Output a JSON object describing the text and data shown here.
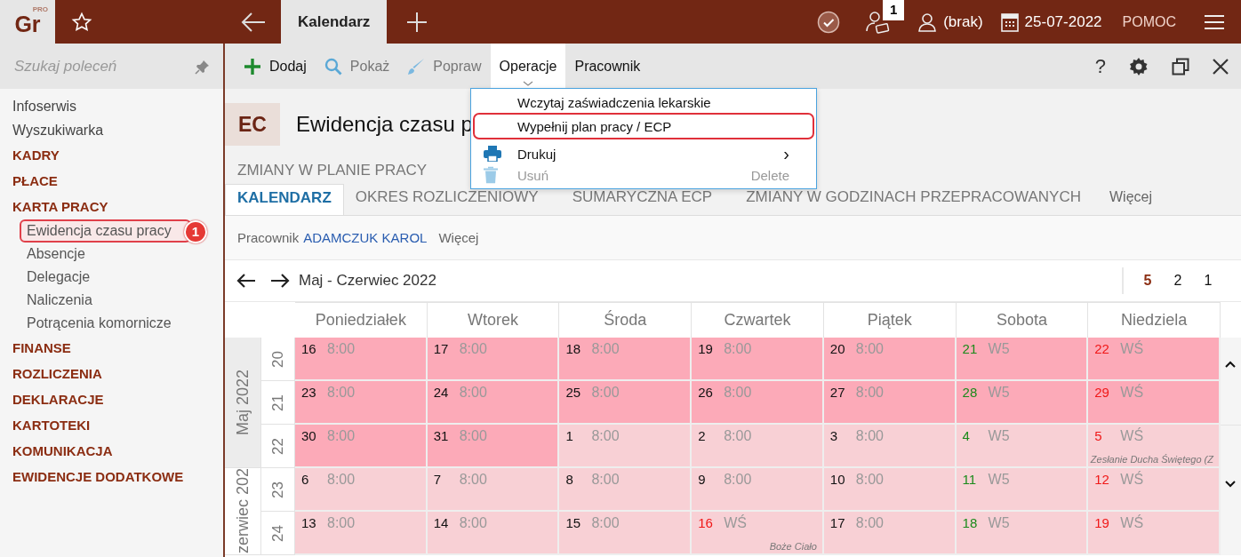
{
  "topbar": {
    "logo": "Gr",
    "logo_badge": "PRO",
    "tabs": [
      {
        "label": "Kalendarz",
        "selected": true
      }
    ],
    "notification_count": "1",
    "user": "(brak)",
    "date": "25-07-2022",
    "help": "POMOC"
  },
  "sidebar": {
    "search": {
      "placeholder": "Szukaj poleceń"
    },
    "items": [
      {
        "label": "Infoserwis",
        "kind": "link"
      },
      {
        "label": "Wyszukiwarka",
        "kind": "link"
      },
      {
        "label": "KADRY",
        "kind": "section"
      },
      {
        "label": "PŁACE",
        "kind": "section"
      },
      {
        "label": "KARTA PRACY",
        "kind": "section",
        "children": [
          {
            "label": "Ewidencja czasu pracy",
            "selected": true,
            "callout": "1"
          },
          {
            "label": "Absencje",
            "selected": false
          },
          {
            "label": "Delegacje",
            "selected": false
          },
          {
            "label": "Naliczenia",
            "selected": false
          },
          {
            "label": "Potrącenia komornicze",
            "selected": false
          }
        ]
      },
      {
        "label": "FINANSE",
        "kind": "section"
      },
      {
        "label": "ROZLICZENIA",
        "kind": "section"
      },
      {
        "label": "DEKLARACJE",
        "kind": "section"
      },
      {
        "label": "KARTOTEKI",
        "kind": "section"
      },
      {
        "label": "KOMUNIKACJA",
        "kind": "section"
      },
      {
        "label": "EWIDENCJE DODATKOWE",
        "kind": "section"
      }
    ]
  },
  "toolbar": {
    "actions": [
      {
        "label": "Dodaj",
        "kind": "add",
        "disabled": false,
        "selected": false
      },
      {
        "label": "Pokaż",
        "kind": "view",
        "disabled": true,
        "selected": false
      },
      {
        "label": "Popraw",
        "kind": "edit",
        "disabled": true,
        "selected": false
      },
      {
        "label": "Operacje",
        "kind": "menu",
        "disabled": false,
        "selected": true
      },
      {
        "label": "Pracownik",
        "kind": "menu",
        "disabled": false,
        "selected": false
      }
    ],
    "help_label": "?"
  },
  "menu": {
    "items": [
      {
        "label": "Wczytaj zaświadczenia lekarskie",
        "kind": "plain",
        "highlighted": false,
        "disabled": false
      },
      {
        "label": "Wypełnij plan pracy / ECP",
        "kind": "plain",
        "highlighted": true,
        "disabled": false
      },
      {
        "label": "Drukuj",
        "kind": "print",
        "submenu": "›",
        "highlighted": false,
        "disabled": false
      },
      {
        "label": "Usuń",
        "kind": "delete",
        "shortcut": "Delete",
        "highlighted": false,
        "disabled": true
      }
    ]
  },
  "header": {
    "badge": "EC",
    "title": "Ewidencja czasu p",
    "subtitle": "ZMIANY W PLANIE PRACY"
  },
  "tabs": [
    {
      "label": "KALENDARZ",
      "selected": true
    },
    {
      "label": "OKRES ROZLICZENIOWY",
      "selected": false
    },
    {
      "label": "SUMARYCZNA ECP",
      "selected": false
    },
    {
      "label": "ZMIANY W GODZINACH PRZEPRACOWANYCH",
      "selected": false
    }
  ],
  "tabs_more": "Więcej",
  "employee": {
    "label": "Pracownik",
    "name": "ADAMCZUK KAROL",
    "more": "Więcej"
  },
  "calendar": {
    "period": "Maj - Czerwiec 2022",
    "view_options": [
      {
        "label": "5",
        "selected": true
      },
      {
        "label": "2",
        "selected": false
      },
      {
        "label": "1",
        "selected": false
      }
    ],
    "weekdays": [
      "Poniedziałek",
      "Wtorek",
      "Środa",
      "Czwartek",
      "Piątek",
      "Sobota",
      "Niedziela"
    ],
    "months": [
      {
        "label": "Maj 2022",
        "highlighted": true,
        "weeks": [
          {
            "number": "20",
            "days": [
              {
                "day": "16",
                "kind": "work",
                "hours": "8:00",
                "highlighted": true
              },
              {
                "day": "17",
                "kind": "work",
                "hours": "8:00",
                "highlighted": true
              },
              {
                "day": "18",
                "kind": "work",
                "hours": "8:00",
                "highlighted": true
              },
              {
                "day": "19",
                "kind": "work",
                "hours": "8:00",
                "highlighted": true
              },
              {
                "day": "20",
                "kind": "work",
                "hours": "8:00",
                "highlighted": true
              },
              {
                "day": "21",
                "kind": "saturday",
                "hours": "W5",
                "highlighted": true
              },
              {
                "day": "22",
                "kind": "holiday",
                "hours": "WŚ",
                "highlighted": true
              }
            ]
          },
          {
            "number": "21",
            "days": [
              {
                "day": "23",
                "kind": "work",
                "hours": "8:00",
                "highlighted": true
              },
              {
                "day": "24",
                "kind": "work",
                "hours": "8:00",
                "highlighted": true
              },
              {
                "day": "25",
                "kind": "work",
                "hours": "8:00",
                "highlighted": true
              },
              {
                "day": "26",
                "kind": "work",
                "hours": "8:00",
                "highlighted": true
              },
              {
                "day": "27",
                "kind": "work",
                "hours": "8:00",
                "highlighted": true
              },
              {
                "day": "28",
                "kind": "saturday",
                "hours": "W5",
                "highlighted": true
              },
              {
                "day": "29",
                "kind": "holiday",
                "hours": "WŚ",
                "highlighted": true
              }
            ]
          },
          {
            "number": "22",
            "days": [
              {
                "day": "30",
                "kind": "work",
                "hours": "8:00",
                "highlighted": true
              },
              {
                "day": "31",
                "kind": "work",
                "hours": "8:00",
                "highlighted": true
              },
              {
                "day": "1",
                "kind": "work",
                "hours": "8:00",
                "highlighted": false
              },
              {
                "day": "2",
                "kind": "work",
                "hours": "8:00",
                "highlighted": false
              },
              {
                "day": "3",
                "kind": "work",
                "hours": "8:00",
                "highlighted": false
              },
              {
                "day": "4",
                "kind": "saturday",
                "hours": "W5",
                "highlighted": false
              },
              {
                "day": "5",
                "kind": "holiday",
                "hours": "WŚ",
                "highlighted": false,
                "note": "Zesłanie Ducha Świętego (Z"
              }
            ]
          }
        ]
      },
      {
        "label": "zerwiec 202",
        "highlighted": false,
        "weeks": [
          {
            "number": "23",
            "days": [
              {
                "day": "6",
                "kind": "work",
                "hours": "8:00",
                "highlighted": false
              },
              {
                "day": "7",
                "kind": "work",
                "hours": "8:00",
                "highlighted": false
              },
              {
                "day": "8",
                "kind": "work",
                "hours": "8:00",
                "highlighted": false
              },
              {
                "day": "9",
                "kind": "work",
                "hours": "8:00",
                "highlighted": false
              },
              {
                "day": "10",
                "kind": "work",
                "hours": "8:00",
                "highlighted": false
              },
              {
                "day": "11",
                "kind": "saturday",
                "hours": "W5",
                "highlighted": false
              },
              {
                "day": "12",
                "kind": "holiday",
                "hours": "WŚ",
                "highlighted": false
              }
            ]
          },
          {
            "number": "24",
            "days": [
              {
                "day": "13",
                "kind": "work",
                "hours": "8:00",
                "highlighted": false
              },
              {
                "day": "14",
                "kind": "work",
                "hours": "8:00",
                "highlighted": false
              },
              {
                "day": "15",
                "kind": "work",
                "hours": "8:00",
                "highlighted": false
              },
              {
                "day": "16",
                "kind": "holiday",
                "hours": "WŚ",
                "highlighted": false,
                "note": "Boże Ciało"
              },
              {
                "day": "17",
                "kind": "work",
                "hours": "8:00",
                "highlighted": false
              },
              {
                "day": "18",
                "kind": "saturday",
                "hours": "W5",
                "highlighted": false
              },
              {
                "day": "19",
                "kind": "holiday",
                "hours": "WŚ",
                "highlighted": false
              }
            ]
          }
        ]
      }
    ]
  }
}
